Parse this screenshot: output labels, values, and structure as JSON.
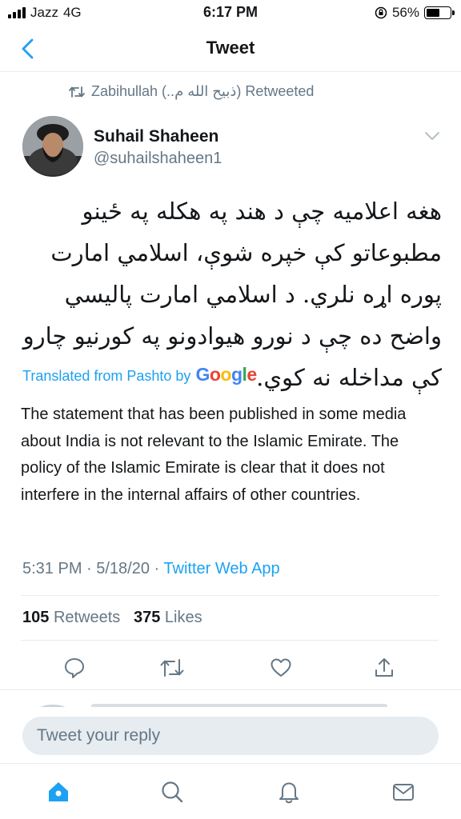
{
  "status_bar": {
    "carrier": "Jazz",
    "network": "4G",
    "time": "6:17 PM",
    "battery": "56%",
    "battery_level": 0.56
  },
  "nav": {
    "title": "Tweet",
    "back_icon": "chevron-left-icon"
  },
  "tweet": {
    "retweeted_by": "Zabihullah (..ذبیح الله م) Retweeted",
    "author_name": "Suhail Shaheen",
    "author_handle": "@suhailshaheen1",
    "text_pashto": "هغه اعلامیه چې د هند په هکله په ځينو مطبوعاتو کې خپره شوې، اسلامي امارت پوره اړه نلري. د اسلامي امارت پالیسي واضح ده چې د نورو هیوادونو په کورنیو چارو کې مداخله نه کوي.",
    "translated_label": "Translated from Pashto by",
    "translation_provider": "Google",
    "translation": "The statement that has been published in some media about India is not relevant to the Islamic Emirate. The policy of the Islamic Emirate is clear that it does not interfere in the internal affairs of other countries.",
    "timestamp": "5:31 PM · 5/18/20 · ",
    "source_app": "Twitter Web App",
    "retweet_count": "105",
    "retweets_label": "Retweets",
    "like_count": "375",
    "likes_label": "Likes"
  },
  "actions": [
    "reply-icon",
    "retweet-icon",
    "like-icon",
    "share-icon"
  ],
  "reply": {
    "placeholder": "Tweet your reply"
  },
  "tabs": [
    "home-icon",
    "search-icon",
    "notifications-icon",
    "messages-icon"
  ],
  "colors": {
    "accent": "#1da1f2",
    "secondary_text": "#657786",
    "divider": "#e6ecf0"
  }
}
